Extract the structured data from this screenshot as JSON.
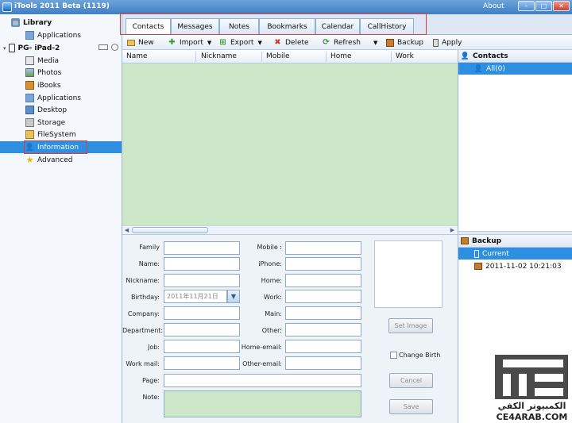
{
  "window": {
    "title": "iTools 2011 Beta (1119)",
    "about": "About"
  },
  "sidebar": {
    "library": "Library",
    "library_applications": "Applications",
    "device": "PG- iPad-2",
    "items": [
      {
        "label": "Media",
        "icon": "media-icon"
      },
      {
        "label": "Photos",
        "icon": "photos-icon"
      },
      {
        "label": "iBooks",
        "icon": "ibooks-icon"
      },
      {
        "label": "Applications",
        "icon": "applications-icon"
      },
      {
        "label": "Desktop",
        "icon": "desktop-icon"
      },
      {
        "label": "Storage",
        "icon": "storage-icon"
      },
      {
        "label": "FileSystem",
        "icon": "filesystem-icon"
      },
      {
        "label": "Information",
        "icon": "information-icon"
      },
      {
        "label": "Advanced",
        "icon": "advanced-icon"
      }
    ],
    "selected": "Information"
  },
  "tabs": [
    "Contacts",
    "Messages",
    "Notes",
    "Bookmarks",
    "Calendar",
    "CallHistory"
  ],
  "active_tab": "Contacts",
  "toolbar": {
    "new": "New",
    "import": "Import",
    "export": "Export",
    "delete": "Delete",
    "refresh": "Refresh",
    "backup": "Backup",
    "apply": "Apply"
  },
  "grid": {
    "columns": [
      "Name",
      "Nickname",
      "Mobile",
      "Home",
      "Work"
    ]
  },
  "contacts_panel": {
    "title": "Contacts",
    "item": "All(0)"
  },
  "backup_panel": {
    "title": "Backup",
    "items": [
      "Current",
      "2011-11-02 10:21:03"
    ]
  },
  "form": {
    "left_labels": [
      "Family",
      "Name:",
      "Nickname:",
      "Birthday:",
      "Company:",
      "Department:",
      "Job:",
      "Work mail:"
    ],
    "right_labels": [
      "Mobile :",
      "iPhone:",
      "Home:",
      "Work:",
      "Main:",
      "Other:",
      "Home-email:",
      "Other-email:"
    ],
    "page_label": "Page:",
    "note_label": "Note:",
    "birthday_value": "2011年11月21日",
    "set_image": "Set Image",
    "change_birth": "Change Birth",
    "cancel": "Cancel",
    "save": "Save"
  },
  "watermark": {
    "arabic": "الكمبيوتر الكفي",
    "site": "CE4ARAB.COM"
  },
  "colors": {
    "selection": "#2e8fe0",
    "grid_bg": "#cde8c9",
    "highlight_outline": "#e03a3a"
  }
}
